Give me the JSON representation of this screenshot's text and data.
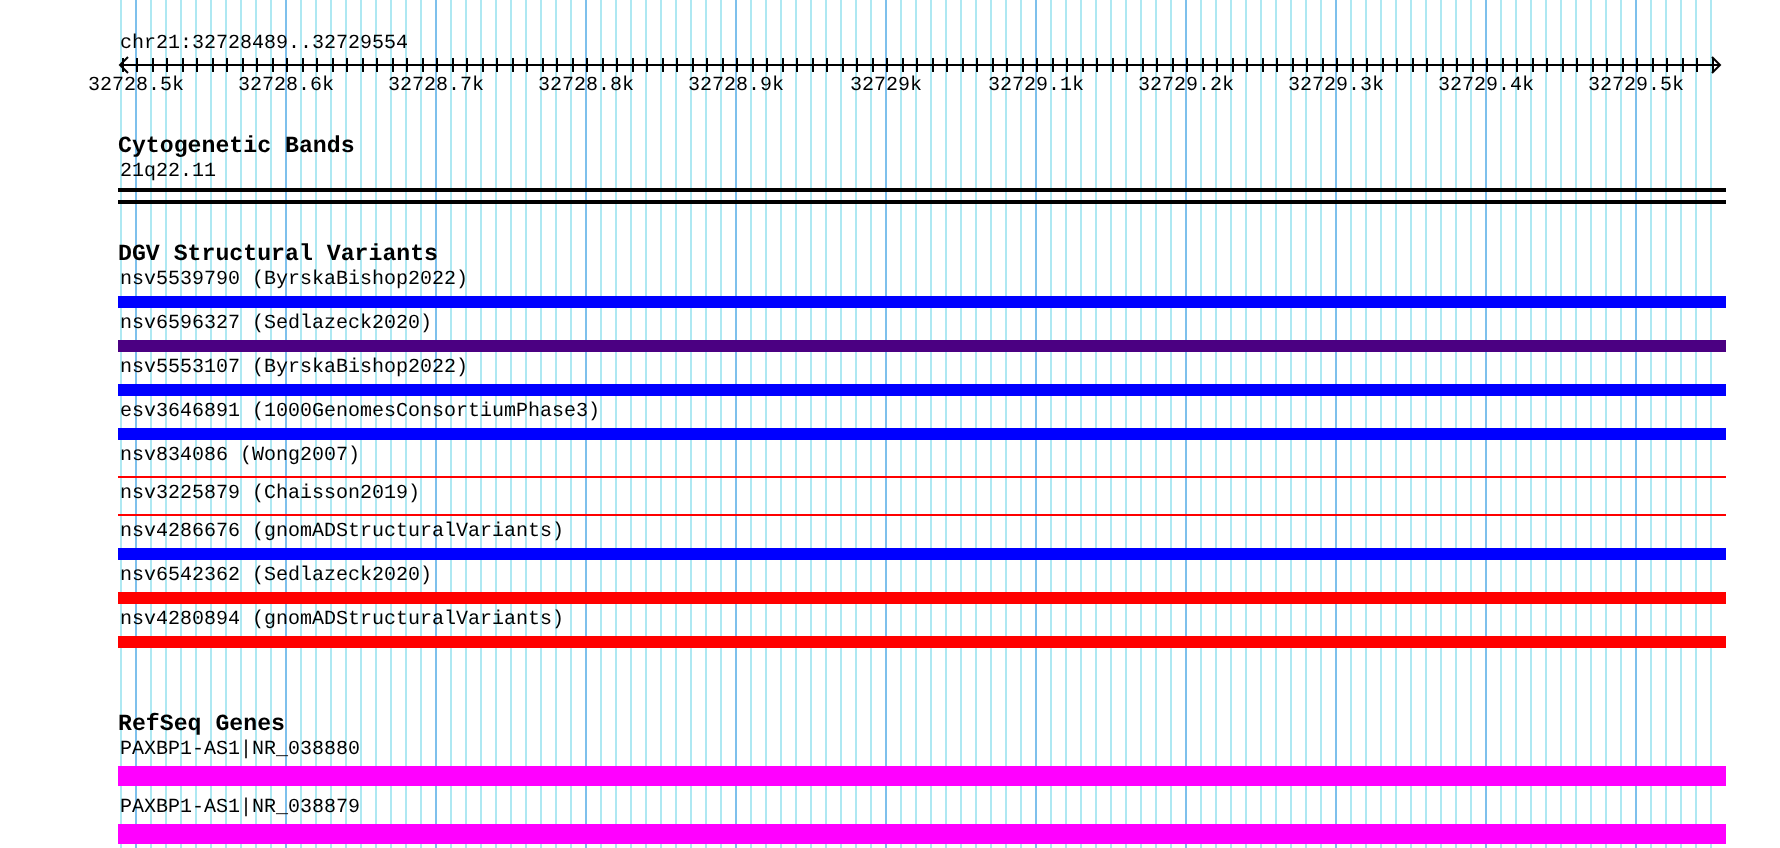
{
  "location": "chr21:32728489..32729554",
  "ruler": {
    "ticks": [
      "32728.5k",
      "32728.6k",
      "32728.7k",
      "32728.8k",
      "32728.9k",
      "32729k",
      "32729.1k",
      "32729.2k",
      "32729.3k",
      "32729.4k",
      "32729.5k"
    ]
  },
  "tracks": [
    {
      "title": "Cytogenetic Bands",
      "features": [
        {
          "label": "21q22.11",
          "kind": "band"
        }
      ]
    },
    {
      "title": "DGV Structural Variants",
      "features": [
        {
          "label": "nsv5539790 (ByrskaBishop2022)",
          "kind": "bar",
          "color": "#0000ff"
        },
        {
          "label": "nsv6596327 (Sedlazeck2020)",
          "kind": "bar",
          "color": "#4b0082"
        },
        {
          "label": "nsv5553107 (ByrskaBishop2022)",
          "kind": "bar",
          "color": "#0000ff"
        },
        {
          "label": "esv3646891 (1000GenomesConsortiumPhase3)",
          "kind": "bar",
          "color": "#0000ff"
        },
        {
          "label": "nsv834086 (Wong2007)",
          "kind": "line",
          "color": "#ff0000"
        },
        {
          "label": "nsv3225879 (Chaisson2019)",
          "kind": "line",
          "color": "#ff0000"
        },
        {
          "label": "nsv4286676 (gnomADStructuralVariants)",
          "kind": "bar",
          "color": "#0000ff"
        },
        {
          "label": "nsv6542362 (Sedlazeck2020)",
          "kind": "bar",
          "color": "#ff0000"
        },
        {
          "label": "nsv4280894 (gnomADStructuralVariants)",
          "kind": "bar",
          "color": "#ff0000"
        }
      ]
    },
    {
      "title": "RefSeq Genes",
      "features": [
        {
          "label": "PAXBP1-AS1|NR_038880",
          "kind": "gene",
          "color": "#ff00ff"
        },
        {
          "label": "PAXBP1-AS1|NR_038879",
          "kind": "gene",
          "color": "#ff00ff"
        }
      ]
    }
  ]
}
